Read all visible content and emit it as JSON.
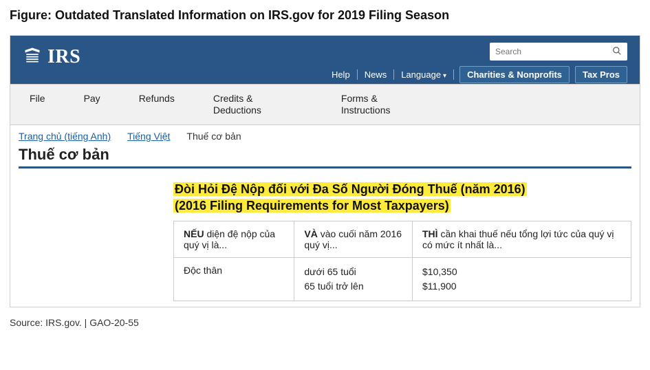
{
  "figure_title": "Figure: Outdated Translated Information on IRS.gov for 2019 Filing Season",
  "header": {
    "logo_text": "IRS",
    "search_placeholder": "Search",
    "links": {
      "help": "Help",
      "news": "News",
      "language": "Language"
    },
    "buttons": {
      "charities": "Charities & Nonprofits",
      "taxpros": "Tax Pros"
    }
  },
  "mainnav": {
    "file": "File",
    "pay": "Pay",
    "refunds": "Refunds",
    "credits_l1": "Credits &",
    "credits_l2": "Deductions",
    "forms_l1": "Forms &",
    "forms_l2": "Instructions"
  },
  "breadcrumb": {
    "home": "Trang chủ (tiếng Anh)",
    "lang": "Tiếng Việt",
    "current": "Thuế cơ bản"
  },
  "page_title": "Thuế cơ bản",
  "highlight": {
    "line1": "Đòi Hỏi Đệ Nộp đối với Đa Số Người Đóng Thuế (năm 2016)",
    "line2": "(2016 Filing Requirements for Most Taxpayers)"
  },
  "table": {
    "header": {
      "col1_pre": "NẾU",
      "col1_rest": " diện đệ nộp của quý vị là...",
      "col2_pre": "VÀ",
      "col2_rest": " vào cuối năm 2016 quý vị...",
      "col3_pre": "THÌ",
      "col3_rest": " cần khai thuế nếu tổng lợi tức của quý vị có mức ít nhất là..."
    },
    "rows": [
      {
        "status": "Độc thân",
        "age1": "dưới 65 tuổi",
        "age2": "65 tuổi trở lên",
        "amt1": "$10,350",
        "amt2": "$11,900"
      }
    ]
  },
  "source": "Source: IRS.gov.  |  GAO-20-55"
}
